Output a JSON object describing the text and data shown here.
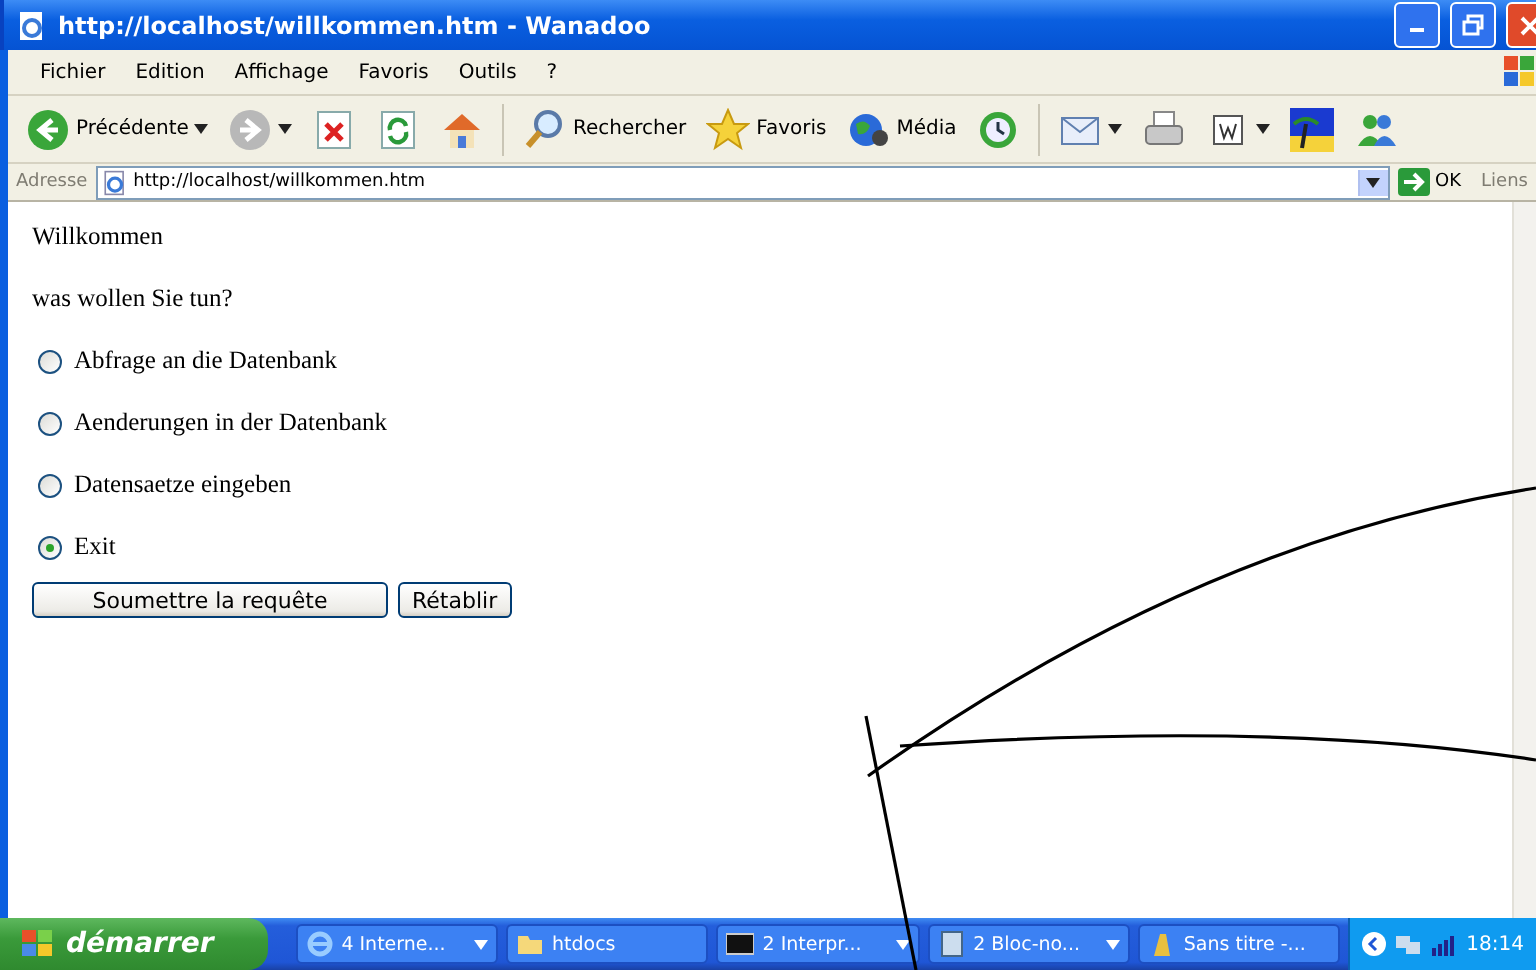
{
  "window": {
    "title": "http://localhost/willkommen.htm - Wanadoo"
  },
  "menu": [
    "Fichier",
    "Edition",
    "Affichage",
    "Favoris",
    "Outils",
    "?"
  ],
  "toolbar": [
    {
      "kind": "back",
      "label": "Précédente",
      "dropdown": true
    },
    {
      "kind": "forward",
      "dropdown": true,
      "disabled": true
    },
    {
      "kind": "stop"
    },
    {
      "kind": "refresh"
    },
    {
      "kind": "home"
    },
    {
      "kind": "search",
      "label": "Rechercher"
    },
    {
      "kind": "favorites",
      "label": "Favoris"
    },
    {
      "kind": "media",
      "label": "Média"
    },
    {
      "kind": "history"
    },
    {
      "kind": "mail",
      "dropdown": true
    },
    {
      "kind": "print"
    },
    {
      "kind": "edit",
      "dropdown": true
    },
    {
      "kind": "beach"
    },
    {
      "kind": "messenger"
    }
  ],
  "address": {
    "label": "Adresse",
    "value": "http://localhost/willkommen.htm",
    "go": "OK",
    "links": "Liens"
  },
  "page": {
    "heading": "Willkommen",
    "question": "was wollen Sie tun?",
    "options": [
      {
        "label": "Abfrage an die Datenbank",
        "selected": false
      },
      {
        "label": "Aenderungen in der Datenbank",
        "selected": false
      },
      {
        "label": "Datensaetze eingeben",
        "selected": false
      },
      {
        "label": "Exit",
        "selected": true
      }
    ],
    "buttons": [
      "Soumettre la requête",
      "Rétablir"
    ]
  },
  "taskbar": {
    "start": "démarrer",
    "tasks": [
      {
        "kind": "ie",
        "label": "4 Interne...",
        "grouped": true
      },
      {
        "kind": "folder",
        "label": "htdocs",
        "grouped": false
      },
      {
        "kind": "cmd",
        "label": "2 Interpr...",
        "grouped": true
      },
      {
        "kind": "notepad",
        "label": "2 Bloc-no...",
        "grouped": true
      },
      {
        "kind": "paint",
        "label": "Sans titre -...",
        "grouped": false
      }
    ],
    "clock": "18:14"
  }
}
